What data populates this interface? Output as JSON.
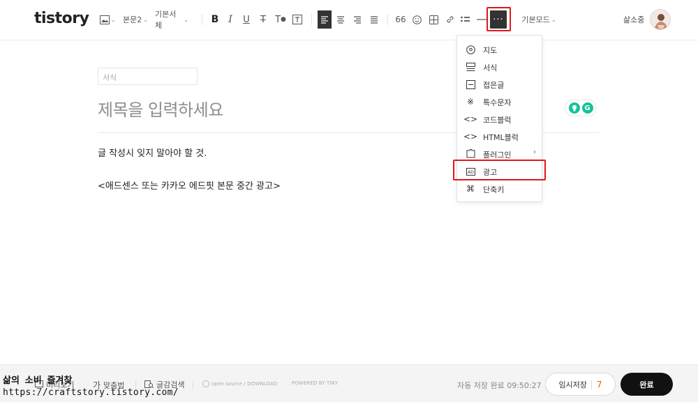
{
  "brand": {
    "logo": "tistory"
  },
  "toolbar": {
    "paragraph_style": "본문2",
    "font": "기본서체",
    "mode": "기본모드",
    "more_label": "···",
    "quote_label": "66"
  },
  "user": {
    "name": "삶소중"
  },
  "editor": {
    "category_placeholder": "서식",
    "title_placeholder": "제목을 입력하세요",
    "body": [
      "글 작성시 잊지 말아야 할 것.",
      "<애드센스 또는 카카오 에드핏 본문 중간 광고>"
    ]
  },
  "more_menu": {
    "items": [
      {
        "icon": "map-pin-icon",
        "label": "지도"
      },
      {
        "icon": "template-icon",
        "label": "서식"
      },
      {
        "icon": "fold-icon",
        "label": "접은글"
      },
      {
        "icon": "special-char-icon",
        "label": "특수문자"
      },
      {
        "icon": "code-icon",
        "label": "코드블럭"
      },
      {
        "icon": "html-icon",
        "label": "HTML블럭"
      },
      {
        "icon": "plugin-icon",
        "label": "플러그인",
        "submenu": "›"
      },
      {
        "icon": "ad-icon",
        "label": "광고"
      },
      {
        "icon": "command-icon",
        "label": "단축키"
      }
    ]
  },
  "bottom": {
    "preview": "미리보기",
    "spellcheck": "맞춤법",
    "search": "글감검색",
    "opensource": "open source / DOWNLOAD",
    "powered": "POWERED BY TINY",
    "autosave": "자동 저장 완료 09:50:27",
    "draft_label": "임시저장",
    "draft_count": "7",
    "done_label": "완료"
  },
  "watermark": {
    "line1": "삶의 소비 즐겨찾",
    "line2": "https://craftstory.tistory.com/"
  },
  "colors": {
    "highlight": "#e0161b",
    "accent_count": "#e05a00",
    "grammarly_green": "#15c39a"
  }
}
